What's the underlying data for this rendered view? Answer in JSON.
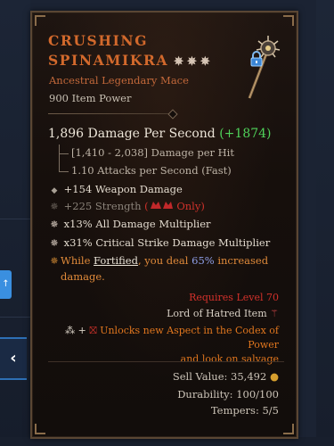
{
  "background": {
    "left_button_label": "↑",
    "left_arrow_glyph": "‹"
  },
  "item": {
    "name_line1": "CRUSHING",
    "name_line2": "SPINAMIKRA",
    "stars": "✵✵✵",
    "subtype": "Ancestral Legendary Mace",
    "item_power": "900 Item Power",
    "dps_value": "1,896 Damage Per Second",
    "dps_change": "(+1874)",
    "damage_per_hit": "[1,410 - 2,038] Damage per Hit",
    "attacks_per_second": "1.10 Attacks per Second (Fast)",
    "affixes": [
      {
        "bullet": "◆",
        "text": "+154 Weapon Damage"
      },
      {
        "bullet": "✵",
        "text": "+225 Strength",
        "restriction": "Only"
      },
      {
        "bullet": "✵",
        "text": "x13% All Damage Multiplier"
      },
      {
        "bullet": "✵",
        "text": "x31% Critical Strike Damage Multiplier"
      }
    ],
    "aspect": {
      "bullet": "✵",
      "prefix": "While ",
      "keyword": "Fortified",
      "middle": ", you deal ",
      "value": "65%",
      "suffix": " increased",
      "line2": "damage."
    },
    "requires_level": "Requires Level 70",
    "lord_item": "Lord of Hatred Item",
    "codex_line1": "Unlocks new Aspect in the Codex of Power",
    "codex_line2": "and look on salvage",
    "sell_value_label": "Sell Value: 35,492",
    "durability": "Durability: 100/100",
    "tempers": "Tempers: 5/5"
  },
  "colors": {
    "title": "#d2692c",
    "subtype": "#c2683a",
    "positive": "#4fd35a",
    "requires": "#d2312b",
    "codex": "#e0761e",
    "aspect_value": "#8f9fe8"
  }
}
